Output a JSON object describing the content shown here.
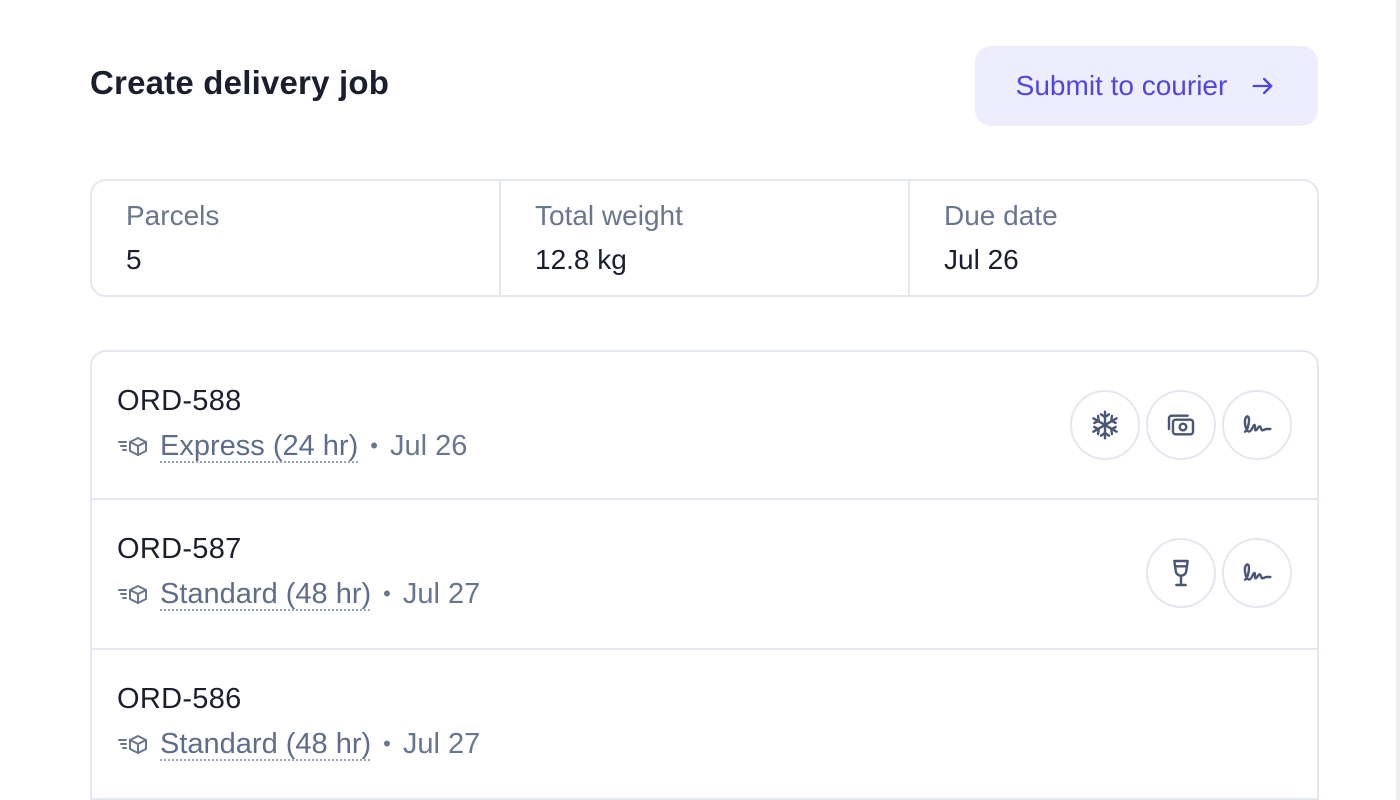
{
  "header": {
    "title": "Create delivery job",
    "submit_label": "Submit to courier"
  },
  "summary": [
    {
      "label": "Parcels",
      "value": "5"
    },
    {
      "label": "Total weight",
      "value": "12.8 kg"
    },
    {
      "label": "Due date",
      "value": "Jul 26"
    }
  ],
  "orders": [
    {
      "id": "ORD-588",
      "service": "Express (24 hr)",
      "date": "Jul 26",
      "icons": [
        "snowflake-icon",
        "cash-icon",
        "signature-icon"
      ]
    },
    {
      "id": "ORD-587",
      "service": "Standard (48 hr)",
      "date": "Jul 27",
      "icons": [
        "wine-glass-icon",
        "signature-icon"
      ]
    },
    {
      "id": "ORD-586",
      "service": "Standard (48 hr)",
      "date": "Jul 27",
      "icons": []
    }
  ],
  "separator": "•",
  "colors": {
    "accent": "#4f46e5",
    "accent_bg": "#eeedfd",
    "muted_text": "#6a7590",
    "border": "#e3e7ef"
  }
}
